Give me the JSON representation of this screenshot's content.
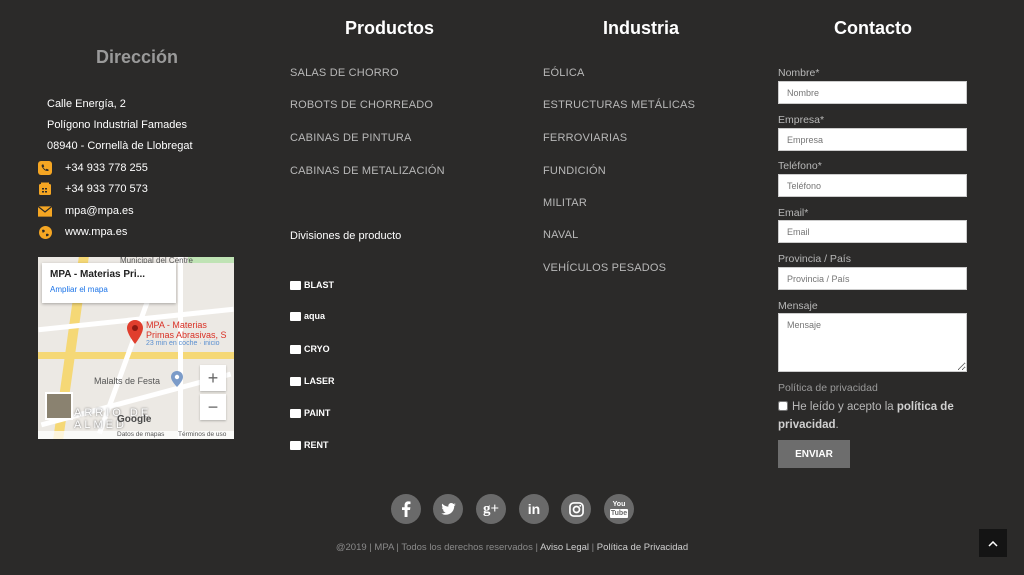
{
  "columns": {
    "productos": "Productos",
    "industria": "Industria",
    "contacto": "Contacto",
    "direccion": "Dirección"
  },
  "address": {
    "line1": "Calle Energía, 2",
    "line2": "Polígono Industrial Famades",
    "line3": "08940 - Cornellà de Llobregat",
    "phone": "+34 933 778 255",
    "fax": "+34 933 770 573",
    "email": "mpa@mpa.es",
    "web": "www.mpa.es"
  },
  "map": {
    "place_title": "MPA - Materias Pri...",
    "enlarge_link": "Ampliar el mapa",
    "marker_label_1": "MPA - Materias",
    "marker_label_2": "Primas Abrasivas, S",
    "route_hint": "23 min en coche · inicio",
    "street_1": "Municipal del Centre",
    "street_2": "Malalts de Festa",
    "district": "ARRIO DE",
    "district_2": "ALMED",
    "zoom_in": "+",
    "zoom_out": "−",
    "footer_data": "Datos de mapas",
    "footer_terms": "Términos de uso",
    "google": "Google"
  },
  "productos": {
    "items": [
      "SALAS DE CHORRO",
      "ROBOTS DE CHORREADO",
      "CABINAS DE PINTURA",
      "CABINAS DE METALIZACIÓN"
    ],
    "divisions_label": "Divisiones de producto",
    "divisions": [
      "BLAST",
      "aqua",
      "CRYO",
      "LASER",
      "PAINT",
      "RENT"
    ]
  },
  "industria": {
    "items": [
      "EÓLICA",
      "ESTRUCTURAS METÁLICAS",
      "FERROVIARIAS",
      "FUNDICIÓN",
      "MILITAR",
      "NAVAL",
      "VEHÍCULOS PESADOS"
    ]
  },
  "form": {
    "nombre_label": "Nombre*",
    "nombre_ph": "Nombre",
    "empresa_label": "Empresa*",
    "empresa_ph": "Empresa",
    "telefono_label": "Teléfono*",
    "telefono_ph": "Teléfono",
    "email_label": "Email*",
    "email_ph": "Email",
    "provincia_label": "Provincia / País",
    "provincia_ph": "Provincia / País",
    "mensaje_label": "Mensaje",
    "mensaje_ph": "Mensaje",
    "privacy_title": "Política de privacidad",
    "privacy_text": "He leído y acepto la",
    "privacy_link": "política de privacidad",
    "privacy_end": ".",
    "send": "ENVIAR"
  },
  "social": [
    "facebook-icon",
    "twitter-icon",
    "google-plus-icon",
    "linkedin-icon",
    "instagram-icon",
    "youtube-icon"
  ],
  "social_glyphs": {
    "google_plus": "g+",
    "linkedin": "in",
    "youtube_top": "You",
    "youtube_bottom": "Tube"
  },
  "footer": {
    "copyright": "@2019 | MPA | Todos los derechos reservados |",
    "aviso": "Aviso Legal",
    "sep": "|",
    "privacidad": "Política de Privacidad"
  },
  "colors": {
    "background": "#2b2a29",
    "accent": "#f5a623",
    "button": "#6d6d6d"
  }
}
